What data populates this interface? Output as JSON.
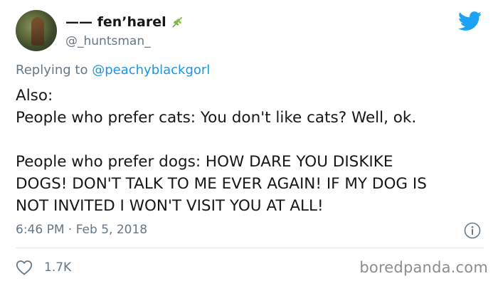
{
  "tweet": {
    "author_name": "—— fen’harel",
    "author_handle": "@_huntsman_",
    "replying_prefix": "Replying to ",
    "replying_to": "@peachyblackgorl",
    "body": [
      "Also:",
      "People who prefer cats: You don't like cats? Well, ok.",
      "",
      "People who prefer dogs: HOW DARE YOU DISKIKE",
      "DOGS! DON'T TALK TO ME EVER AGAIN! IF MY DOG IS",
      "NOT INVITED I WON'T VISIT YOU AT ALL!"
    ],
    "timestamp": "6:46 PM · Feb 5, 2018",
    "like_count": "1.7K"
  },
  "watermark": "boredpanda.com",
  "colors": {
    "text": "#14171a",
    "muted": "#657786",
    "link": "#1b95e0",
    "twitter_blue": "#1da1f2",
    "divider": "#e1e8ed"
  },
  "icons": [
    "leaf-icon",
    "twitter-bird-icon",
    "info-icon",
    "heart-icon"
  ]
}
